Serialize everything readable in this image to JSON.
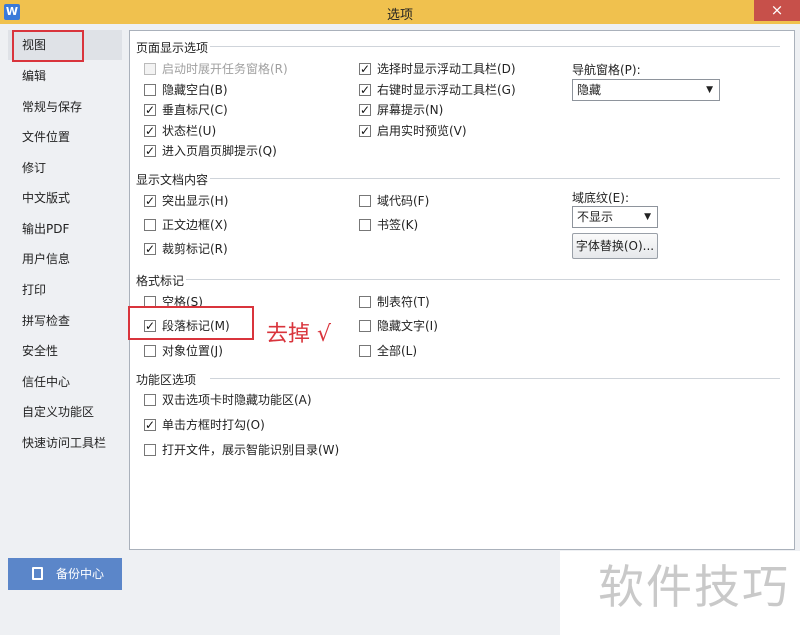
{
  "window": {
    "title": "选项",
    "logo": "W",
    "close_label": "×"
  },
  "sidebar": {
    "items": [
      {
        "label": "视图",
        "active": true
      },
      {
        "label": "编辑"
      },
      {
        "label": "常规与保存"
      },
      {
        "label": "文件位置"
      },
      {
        "label": "修订"
      },
      {
        "label": "中文版式"
      },
      {
        "label": "输出PDF"
      },
      {
        "label": "用户信息"
      },
      {
        "label": "打印"
      },
      {
        "label": "拼写检查"
      },
      {
        "label": "安全性"
      },
      {
        "label": "信任中心"
      },
      {
        "label": "自定义功能区"
      },
      {
        "label": "快速访问工具栏"
      }
    ],
    "backup_label": "备份中心"
  },
  "sections": {
    "page_display": {
      "title": "页面显示选项",
      "col1": [
        {
          "label": "启动时展开任务窗格(R)",
          "checked": false,
          "disabled": true
        },
        {
          "label": "隐藏空白(B)",
          "checked": false
        },
        {
          "label": "垂直标尺(C)",
          "checked": true
        },
        {
          "label": "状态栏(U)",
          "checked": true
        },
        {
          "label": "进入页眉页脚提示(Q)",
          "checked": true
        }
      ],
      "col2": [
        {
          "label": "选择时显示浮动工具栏(D)",
          "checked": true
        },
        {
          "label": "右键时显示浮动工具栏(G)",
          "checked": true
        },
        {
          "label": "屏幕提示(N)",
          "checked": true
        },
        {
          "label": "启用实时预览(V)",
          "checked": true
        }
      ],
      "nav_label": "导航窗格(P):",
      "nav_value": "隐藏"
    },
    "doc_content": {
      "title": "显示文档内容",
      "col1": [
        {
          "label": "突出显示(H)",
          "checked": true
        },
        {
          "label": "正文边框(X)",
          "checked": false
        },
        {
          "label": "裁剪标记(R)",
          "checked": true
        }
      ],
      "col2": [
        {
          "label": "域代码(F)",
          "checked": false
        },
        {
          "label": "书签(K)",
          "checked": false
        }
      ],
      "shading_label": "域底纹(E):",
      "shading_value": "不显示",
      "font_sub_label": "字体替换(O)..."
    },
    "format_marks": {
      "title": "格式标记",
      "col1": [
        {
          "label": "空格(S)",
          "checked": false
        },
        {
          "label": "段落标记(M)",
          "checked": true
        },
        {
          "label": "对象位置(J)",
          "checked": false
        }
      ],
      "col2": [
        {
          "label": "制表符(T)",
          "checked": false
        },
        {
          "label": "隐藏文字(I)",
          "checked": false
        },
        {
          "label": "全部(L)",
          "checked": false
        }
      ]
    },
    "ribbon": {
      "title": "功能区选项",
      "items": [
        {
          "label": "双击选项卡时隐藏功能区(A)",
          "checked": false
        },
        {
          "label": "单击方框时打勾(O)",
          "checked": true
        },
        {
          "label": "打开文件，展示智能识别目录(W)",
          "checked": false
        }
      ]
    }
  },
  "annotation": "去掉 √",
  "watermark": "软件技巧",
  "colors": {
    "titlebar": "#f0c14e",
    "accent": "#5b86c9",
    "highlight": "#d9343c",
    "close": "#c7504a"
  }
}
